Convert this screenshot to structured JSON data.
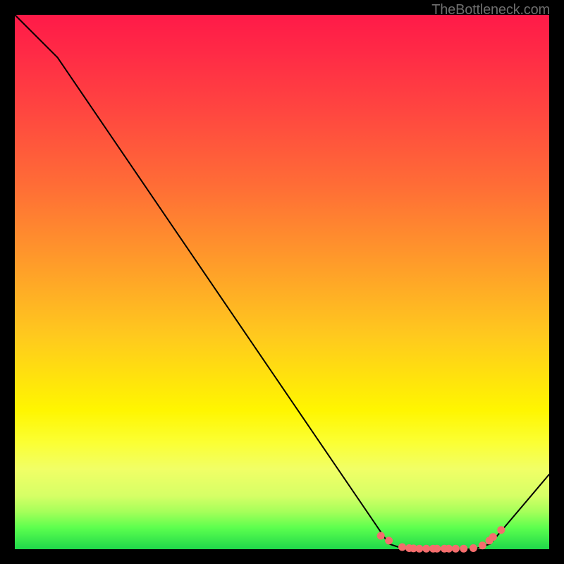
{
  "watermark": "TheBottleneck.com",
  "chart_data": {
    "type": "line",
    "title": "",
    "xlabel": "",
    "ylabel": "",
    "xlim": [
      0,
      100
    ],
    "ylim": [
      0,
      100
    ],
    "series": [
      {
        "name": "bottleneck-curve",
        "x": [
          0,
          8,
          70,
          73,
          86,
          89,
          100
        ],
        "y": [
          100,
          92,
          1,
          0,
          0,
          1,
          14
        ]
      }
    ],
    "markers": {
      "name": "highlight-dots",
      "color": "#f46d6d",
      "points": [
        {
          "x": 68.5,
          "y": 2.5
        },
        {
          "x": 70.0,
          "y": 1.6
        },
        {
          "x": 72.5,
          "y": 0.4
        },
        {
          "x": 73.8,
          "y": 0.2
        },
        {
          "x": 74.6,
          "y": 0.15
        },
        {
          "x": 75.7,
          "y": 0.1
        },
        {
          "x": 77.0,
          "y": 0.1
        },
        {
          "x": 78.3,
          "y": 0.1
        },
        {
          "x": 79.0,
          "y": 0.1
        },
        {
          "x": 80.4,
          "y": 0.1
        },
        {
          "x": 81.2,
          "y": 0.1
        },
        {
          "x": 82.5,
          "y": 0.1
        },
        {
          "x": 84.0,
          "y": 0.1
        },
        {
          "x": 85.8,
          "y": 0.2
        },
        {
          "x": 87.5,
          "y": 0.7
        },
        {
          "x": 88.8,
          "y": 1.6
        },
        {
          "x": 89.5,
          "y": 2.3
        },
        {
          "x": 91.0,
          "y": 3.6
        }
      ]
    }
  }
}
